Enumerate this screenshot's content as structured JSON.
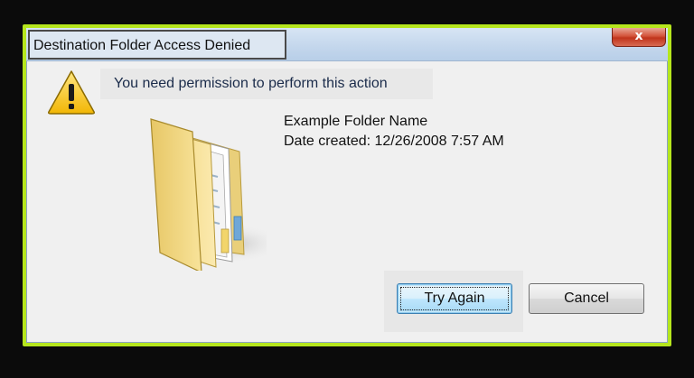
{
  "window": {
    "title": "Destination Folder Access Denied",
    "close_label": "x"
  },
  "message": {
    "heading": "You need permission to perform this action",
    "folder_name": "Example Folder Name",
    "date_created": "Date created: 12/26/2008 7:57 AM"
  },
  "icons": {
    "warning": "warning-icon",
    "folder": "folder-icon",
    "close": "close-icon"
  },
  "buttons": {
    "try_again_label": "Try Again",
    "cancel_label": "Cancel"
  },
  "colors": {
    "highlight_frame": "#b5e61d",
    "background": "#0b0b0b",
    "close_button": "#c0341c"
  }
}
